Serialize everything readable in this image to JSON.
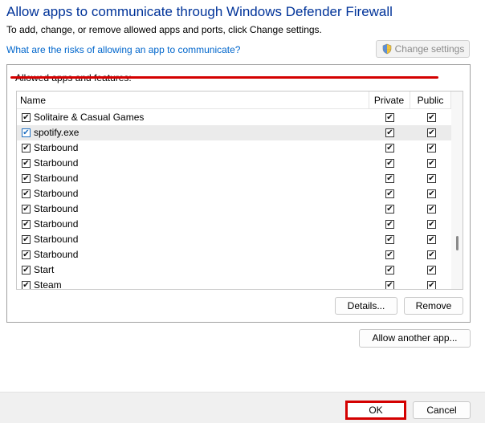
{
  "title": "Allow apps to communicate through Windows Defender Firewall",
  "subtitle": "To add, change, or remove allowed apps and ports, click Change settings.",
  "risk_link": "What are the risks of allowing an app to communicate?",
  "change_settings": "Change settings",
  "group_label": "Allowed apps and features:",
  "columns": {
    "name": "Name",
    "private": "Private",
    "public": "Public"
  },
  "apps": [
    {
      "name": "Solitaire & Casual Games",
      "enabled": true,
      "private": true,
      "public": true
    },
    {
      "name": "spotify.exe",
      "enabled": true,
      "private": true,
      "public": true,
      "selected": true
    },
    {
      "name": "Starbound",
      "enabled": true,
      "private": true,
      "public": true
    },
    {
      "name": "Starbound",
      "enabled": true,
      "private": true,
      "public": true
    },
    {
      "name": "Starbound",
      "enabled": true,
      "private": true,
      "public": true
    },
    {
      "name": "Starbound",
      "enabled": true,
      "private": true,
      "public": true
    },
    {
      "name": "Starbound",
      "enabled": true,
      "private": true,
      "public": true
    },
    {
      "name": "Starbound",
      "enabled": true,
      "private": true,
      "public": true
    },
    {
      "name": "Starbound",
      "enabled": true,
      "private": true,
      "public": true
    },
    {
      "name": "Starbound",
      "enabled": true,
      "private": true,
      "public": true
    },
    {
      "name": "Start",
      "enabled": true,
      "private": true,
      "public": true
    },
    {
      "name": "Steam",
      "enabled": true,
      "private": true,
      "public": true
    }
  ],
  "buttons": {
    "details": "Details...",
    "remove": "Remove",
    "allow_another": "Allow another app...",
    "ok": "OK",
    "cancel": "Cancel"
  },
  "icons": {
    "change_settings": "uac-shield-icon",
    "checkbox_mark": "✔"
  },
  "colors": {
    "title": "#003399",
    "link": "#0066cc",
    "highlight": "#d40000"
  }
}
